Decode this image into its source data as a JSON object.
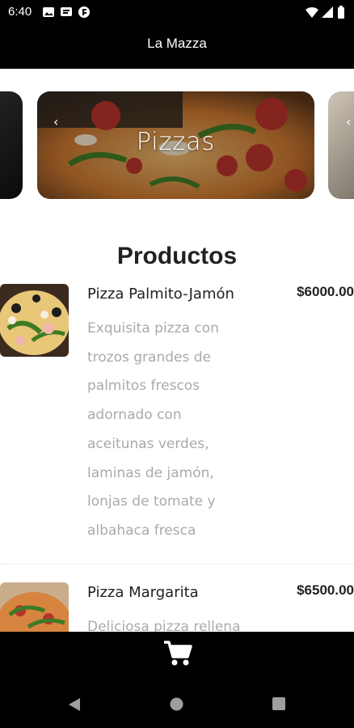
{
  "status": {
    "time": "6:40"
  },
  "app": {
    "title": "La Mazza"
  },
  "carousel": {
    "active_label": "Pizzas",
    "prev_chevron": "‹",
    "next_chevron": "‹"
  },
  "section": {
    "title": "Productos"
  },
  "products": [
    {
      "name": "Pizza Palmito-Jamón",
      "price": "$6000.00",
      "description": "Exquisita pizza con trozos grandes de palmitos frescos adornado con aceitunas verdes, laminas de jamón, lonjas de tomate y albahaca fresca"
    },
    {
      "name": "Pizza Margarita",
      "price": "$6500.00",
      "description": "Deliciosa pizza rellena"
    }
  ],
  "icons": {
    "status": [
      "photo-icon",
      "message-icon",
      "app-notification-icon",
      "wifi-icon",
      "signal-icon",
      "battery-icon"
    ],
    "bottom": "cart-icon",
    "nav": [
      "back-icon",
      "home-icon",
      "recents-icon"
    ]
  },
  "colors": {
    "bar": "#000000",
    "text": "#222222",
    "muted": "#aaaaaa"
  }
}
